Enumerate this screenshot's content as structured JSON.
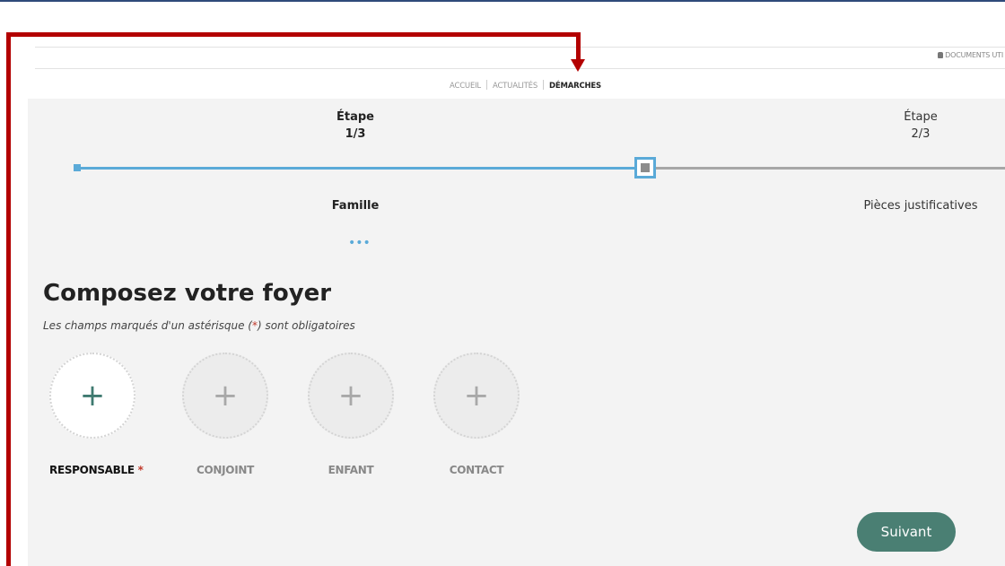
{
  "header": {
    "documents_link": "DOCUMENTS UTI",
    "nav": [
      "ACCUEIL",
      "ACTUALITÉS",
      "DÉMARCHES"
    ],
    "active_nav": "DÉMARCHES"
  },
  "stepper": {
    "steps": [
      {
        "title": "Étape",
        "index": "1/3",
        "label": "Famille",
        "state": "active"
      },
      {
        "title": "Étape",
        "index": "2/3",
        "label": "Pièces justificatives",
        "state": "upcoming"
      }
    ],
    "more_indicator": "•••"
  },
  "form": {
    "title": "Composez votre foyer",
    "note_before": "Les champs marqués d'un astérisque (",
    "note_star": "*",
    "note_after": ") sont obligatoires",
    "members": [
      {
        "label": "RESPONSABLE",
        "required_mark": "*",
        "icon": "plus-icon"
      },
      {
        "label": "CONJOINT",
        "icon": "plus-icon"
      },
      {
        "label": "ENFANT",
        "icon": "plus-icon"
      },
      {
        "label": "CONTACT",
        "icon": "plus-icon"
      }
    ],
    "plus_glyph": "+",
    "next_button": "Suivant"
  },
  "colors": {
    "accent_blue": "#5aaad8",
    "button_green": "#4a7f73",
    "annotation_red": "#b30000",
    "required_red": "#c0392b"
  }
}
